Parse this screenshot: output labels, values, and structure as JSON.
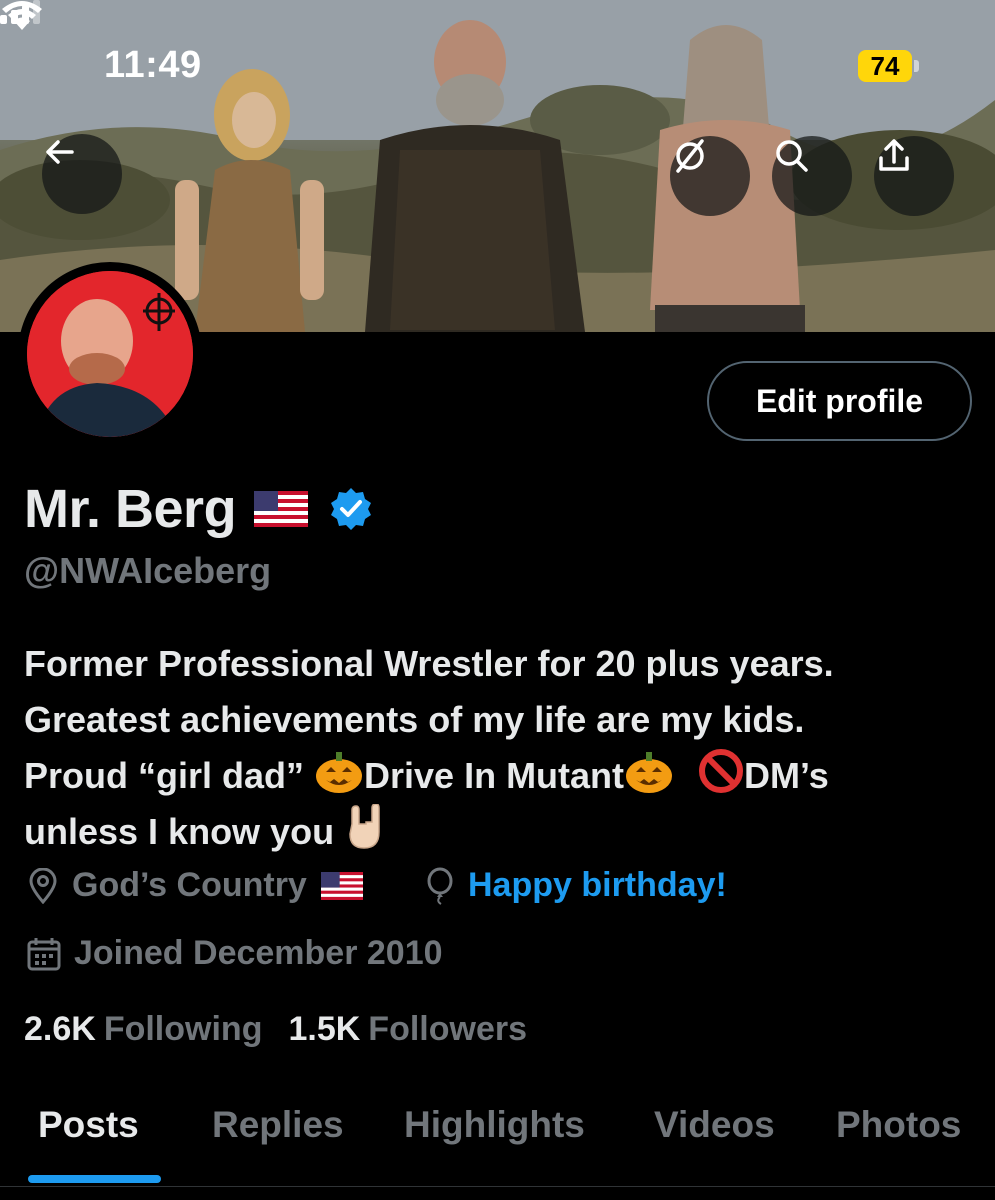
{
  "status_bar": {
    "time": "11:49",
    "battery": "74",
    "battery_color": "#ffd60a"
  },
  "header": {
    "back_icon": "arrow-left-icon",
    "grok_icon": "grok-icon",
    "search_icon": "search-icon",
    "share_icon": "share-icon",
    "banner_description_colors": [
      "#9aa3ab",
      "#5e5d48"
    ]
  },
  "profile": {
    "avatar_bg": "#e3262c",
    "edit_button_label": "Edit profile",
    "display_name": "Mr. Berg",
    "name_flag_icon": "us-flag-icon",
    "verified_icon": "verified-badge-icon",
    "verified_color": "#1d9bf0",
    "handle": "@NWAIceberg",
    "bio": {
      "line1": "Former Professional Wrestler for 20 plus years.",
      "line2": "Greatest achievements of my life are my kids.",
      "line3_a": "Proud “girl dad” ",
      "line3_b": "Drive In Mutant",
      "line3_c": "DM’s",
      "line4": "unless I know you "
    },
    "location": "God’s Country",
    "birthday": "Happy birthday!",
    "joined": "Joined December 2010",
    "following_count": "2.6K",
    "following_label": "Following",
    "followers_count": "1.5K",
    "followers_label": "Followers"
  },
  "tabs": [
    {
      "label": "Posts",
      "active": true
    },
    {
      "label": "Replies",
      "active": false
    },
    {
      "label": "Highlights",
      "active": false
    },
    {
      "label": "Videos",
      "active": false
    },
    {
      "label": "Photos",
      "active": false
    }
  ],
  "colors": {
    "accent": "#1d9bf0",
    "muted": "#71767b",
    "text": "#e7e9ea",
    "background": "#000000"
  }
}
